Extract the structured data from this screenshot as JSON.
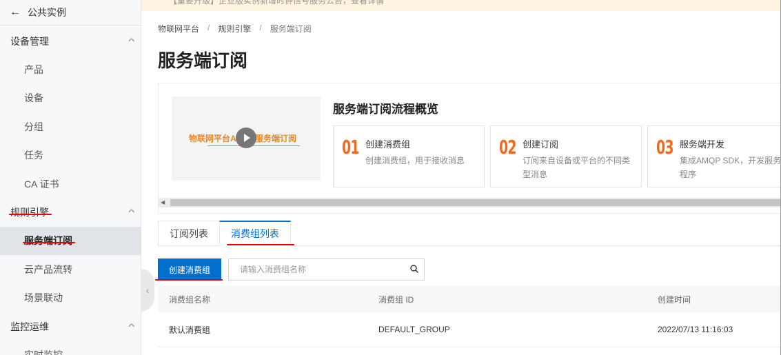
{
  "sidebar": {
    "back_label": "公共实例",
    "groups": [
      {
        "label": "设备管理",
        "items": [
          "产品",
          "设备",
          "分组",
          "任务",
          "CA 证书"
        ]
      },
      {
        "label": "规则引擎",
        "items": [
          "服务端订阅",
          "云产品流转",
          "场景联动"
        ]
      },
      {
        "label": "监控运维",
        "items": [
          "实时监控"
        ]
      }
    ]
  },
  "notice": "【重要升级】企业版实例新增时钟信号服务公告，查看详情",
  "breadcrumb": [
    "物联网平台",
    "规则引擎",
    "服务端订阅"
  ],
  "page_title": "服务端订阅",
  "overview": {
    "video_text": "物联网平台AMQP服务端订阅",
    "title": "服务端订阅流程概览",
    "steps": [
      {
        "num": "01",
        "title": "创建消费组",
        "desc": "创建消费组，用于接收消息"
      },
      {
        "num": "02",
        "title": "创建订阅",
        "desc": "订阅来自设备或平台的不同类型消息"
      },
      {
        "num": "03",
        "title": "服务端开发",
        "desc": "集成AMQP SDK，开发服务端程序"
      }
    ]
  },
  "tabs": [
    "订阅列表",
    "消费组列表"
  ],
  "toolbar": {
    "create_label": "创建消费组",
    "search_placeholder": "请输入消费组名称"
  },
  "table": {
    "headers": [
      "消费组名称",
      "消费组 ID",
      "创建时间"
    ],
    "rows": [
      [
        "默认消费组",
        "DEFAULT_GROUP",
        "2022/07/13 11:16:03"
      ]
    ]
  },
  "colors": {
    "accent": "#0070cc",
    "step_number": "#f06a1f",
    "annotation_red": "#e00000"
  }
}
